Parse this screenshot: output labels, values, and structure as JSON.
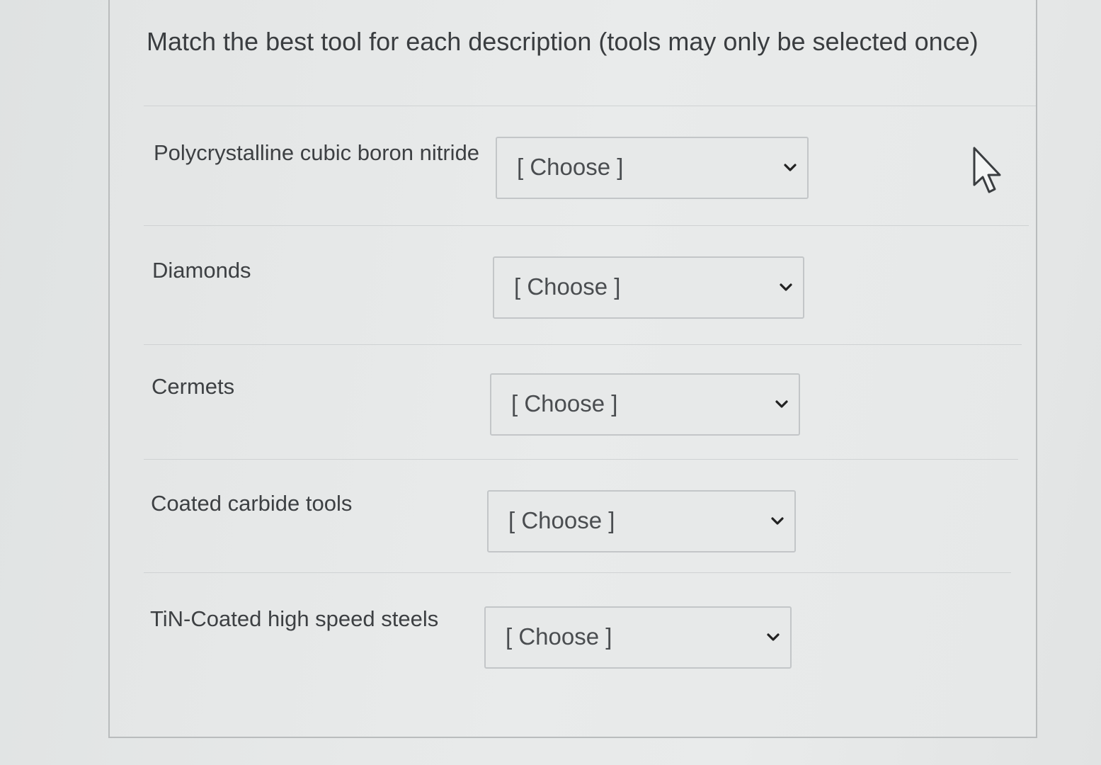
{
  "question": {
    "title": "Match the best tool for each description (tools may only be selected once)"
  },
  "rows": [
    {
      "label": "Polycrystalline cubic boron nitride",
      "select_value": "[ Choose ]"
    },
    {
      "label": "Diamonds",
      "select_value": "[ Choose ]"
    },
    {
      "label": "Cermets",
      "select_value": "[ Choose ]"
    },
    {
      "label": "Coated carbide tools",
      "select_value": "[ Choose ]"
    },
    {
      "label": "TiN-Coated high speed steels",
      "select_value": "[ Choose ]"
    }
  ],
  "icons": {
    "dropdown": "chevron-down-icon",
    "pointer": "mouse-pointer-icon"
  },
  "colors": {
    "text": "#3d4043",
    "border": "#c3c6c8",
    "background": "#e7e9e9"
  }
}
